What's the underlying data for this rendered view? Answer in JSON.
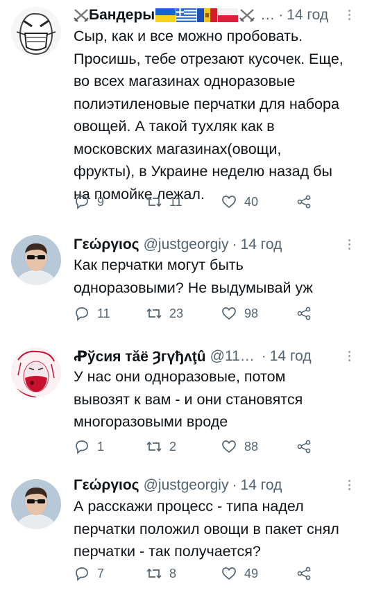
{
  "tweets": [
    {
      "name": "Бандеры",
      "handle": "",
      "ellipsis": "…",
      "time": "14 год",
      "text": "Сыр, как и все можно пробовать.\nПросишь, тебе отрезают кусочек. Еще,\nво всех магазинах одноразовые\nполиэтиленовые перчатки для набора\nовощей. А такой тухляк как в\nмосковских магазинах(овощи,\nфрукты), в Украине неделю назад бы\nна помойке лежал.",
      "replies": "9",
      "retweets": "11",
      "likes": "40"
    },
    {
      "name": "Γεώργιος",
      "handle": "@justgeorgiy",
      "time": "14 год",
      "text": "Как перчатки могут быть\nодноразовыми? Не выдумывай уж",
      "replies": "11",
      "retweets": "23",
      "likes": "98"
    },
    {
      "name": "Ꝓўсия тӑё Ȝгүђʌţû",
      "handle": "@11…",
      "time": "14 год",
      "text": "У нас они одноразовые, потом\nвывозят к вам - и они становятся\nмногоразовыми вроде",
      "replies": "1",
      "retweets": "2",
      "likes": "88"
    },
    {
      "name": "Γεώργιος",
      "handle": "@justgeorgiy",
      "time": "14 год",
      "text": "А расскажи процесс - типа надел\nперчатки положил овощи в пакет снял\nперчатки - так получается?",
      "replies": "7",
      "retweets": "8",
      "likes": "49"
    }
  ],
  "colors": {
    "text": "#0f1419",
    "muted": "#536471",
    "background": "#ffffff"
  },
  "icons": [
    "crossed-swords-icon",
    "ukraine-flag-icon",
    "greece-flag-icon",
    "moldova-flag-icon",
    "poland-flag-icon",
    "reply-icon",
    "retweet-icon",
    "like-icon",
    "share-icon",
    "more-icon"
  ]
}
